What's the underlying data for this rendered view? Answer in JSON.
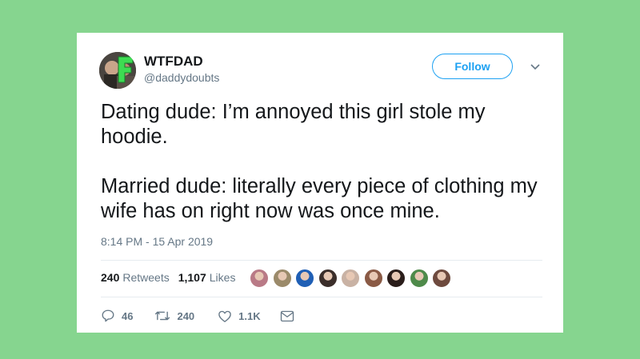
{
  "user": {
    "name": "WTFDAD",
    "handle": "@daddydoubts",
    "follow_label": "Follow"
  },
  "tweet": {
    "paragraph1": "Dating dude: I’m annoyed this girl stole my hoodie.",
    "paragraph2": "Married dude: literally every piece of clothing my wife has on right now was once mine.",
    "timestamp": "8:14 PM - 15 Apr 2019"
  },
  "stats": {
    "retweets_count": "240",
    "retweets_label": "Retweets",
    "likes_count": "1,107",
    "likes_label": "Likes"
  },
  "liker_avatars": [
    {
      "icon": "avatar-1",
      "color": "#b97a86"
    },
    {
      "icon": "avatar-2",
      "color": "#9b8a6a"
    },
    {
      "icon": "avatar-3",
      "color": "#1f5fb5"
    },
    {
      "icon": "avatar-4",
      "color": "#3b2e2a"
    },
    {
      "icon": "avatar-5",
      "color": "#c9b2a4"
    },
    {
      "icon": "avatar-6",
      "color": "#8a5a45"
    },
    {
      "icon": "avatar-7",
      "color": "#2a1d1a"
    },
    {
      "icon": "avatar-8",
      "color": "#4e8a4a"
    },
    {
      "icon": "avatar-9",
      "color": "#6e4a3e"
    }
  ],
  "actions": {
    "replies": "46",
    "retweets": "240",
    "likes": "1.1K"
  },
  "colors": {
    "background": "#86d58f",
    "accent": "#1da1f2",
    "muted": "#657786"
  }
}
